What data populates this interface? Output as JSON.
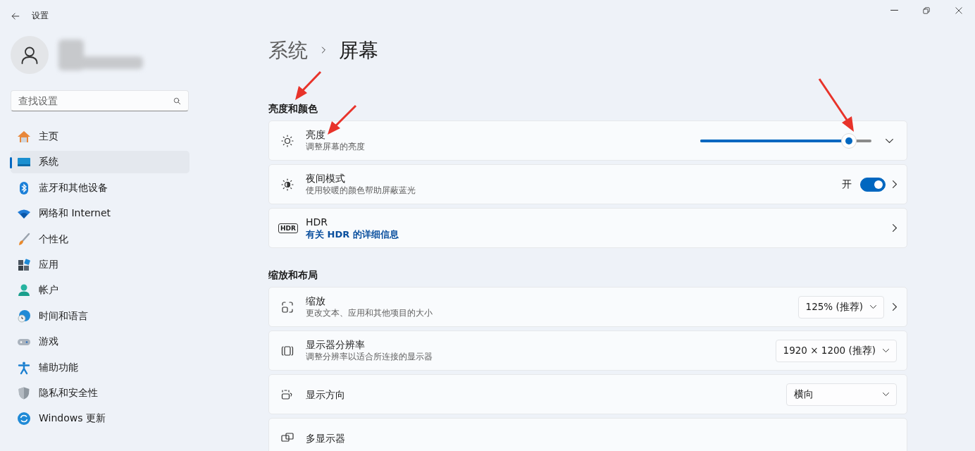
{
  "window": {
    "title": "设置"
  },
  "search": {
    "placeholder": "查找设置"
  },
  "sidebar": {
    "items": [
      {
        "label": "主页",
        "selected": false
      },
      {
        "label": "系统",
        "selected": true
      },
      {
        "label": "蓝牙和其他设备",
        "selected": false
      },
      {
        "label": "网络和 Internet",
        "selected": false
      },
      {
        "label": "个性化",
        "selected": false
      },
      {
        "label": "应用",
        "selected": false
      },
      {
        "label": "帐户",
        "selected": false
      },
      {
        "label": "时间和语言",
        "selected": false
      },
      {
        "label": "游戏",
        "selected": false
      },
      {
        "label": "辅助功能",
        "selected": false
      },
      {
        "label": "隐私和安全性",
        "selected": false
      },
      {
        "label": "Windows 更新",
        "selected": false
      }
    ]
  },
  "breadcrumb": [
    "系统",
    "屏幕"
  ],
  "sections": [
    {
      "title": "亮度和颜色",
      "rows": [
        {
          "kind": "slider",
          "title": "亮度",
          "subtitle": "调整屏幕的亮度",
          "level": 0.87,
          "expanded": false
        },
        {
          "kind": "toggle",
          "title": "夜间模式",
          "subtitle": "使用较暖的颜色帮助屏蔽蓝光",
          "state_label": "开",
          "on": true,
          "opens_page": true
        },
        {
          "kind": "link",
          "icon_text": "HDR",
          "title": "HDR",
          "link": "有关 HDR 的详细信息",
          "opens_page": true
        }
      ]
    },
    {
      "title": "缩放和布局",
      "rows": [
        {
          "kind": "dropdown",
          "title": "缩放",
          "subtitle": "更改文本、应用和其他项目的大小",
          "value": "125% (推荐)",
          "opens_page": true
        },
        {
          "kind": "dropdown",
          "title": "显示器分辨率",
          "subtitle": "调整分辨率以适合所连接的显示器",
          "value": "1920 × 1200 (推荐)",
          "opens_page": false
        },
        {
          "kind": "dropdown",
          "title": "显示方向",
          "value": "横向",
          "opens_page": false
        },
        {
          "kind": "plain",
          "title": "多显示器"
        }
      ]
    }
  ]
}
